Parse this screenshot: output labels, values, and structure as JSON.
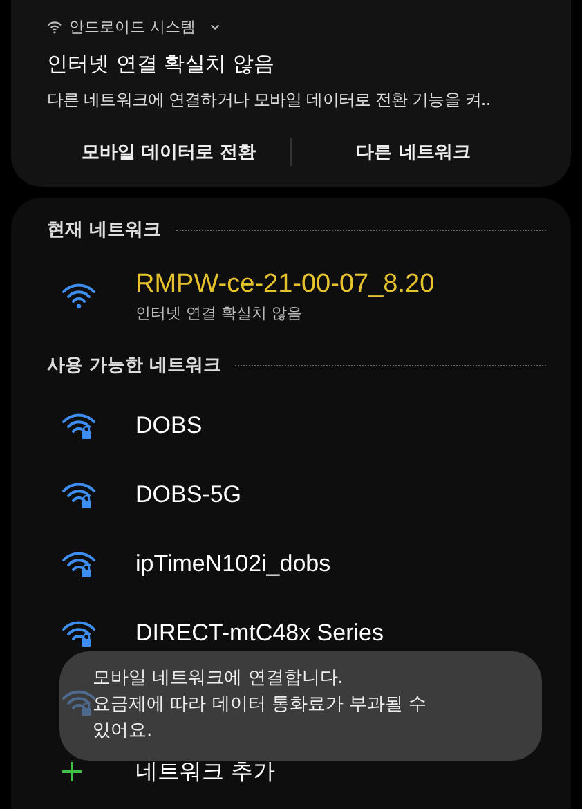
{
  "notification": {
    "app_name": "안드로이드 시스템",
    "expanded": false,
    "title": "인터넷 연결 확실치 않음",
    "body": "다른 네트워크에 연결하거나 모바일 데이터로 전환 기능을 켜..",
    "actions": [
      "모바일 데이터로 전환",
      "다른 네트워크"
    ]
  },
  "current_section": {
    "title": "현재 네트워크",
    "networks": [
      {
        "name": "RMPW-ce-21-00-07_8.20",
        "status": "인터넷 연결 확실치 않음",
        "secured": false,
        "connected": true
      }
    ]
  },
  "available_section": {
    "title": "사용 가능한 네트워크",
    "networks": [
      {
        "name": "DOBS",
        "secured": true,
        "connected": false
      },
      {
        "name": "DOBS-5G",
        "secured": true,
        "connected": false
      },
      {
        "name": "ipTimeN102i_dobs",
        "secured": true,
        "connected": false
      },
      {
        "name": "DIRECT-mtC48x Series",
        "secured": true,
        "connected": false
      },
      {
        "secured": true
      }
    ]
  },
  "add_network": {
    "label": "네트워크 추가"
  },
  "toast": {
    "text": "모바일 네트워크에 연결합니다.\n요금제에 따라 데이터 통화료가 부과될 수 있어요."
  }
}
